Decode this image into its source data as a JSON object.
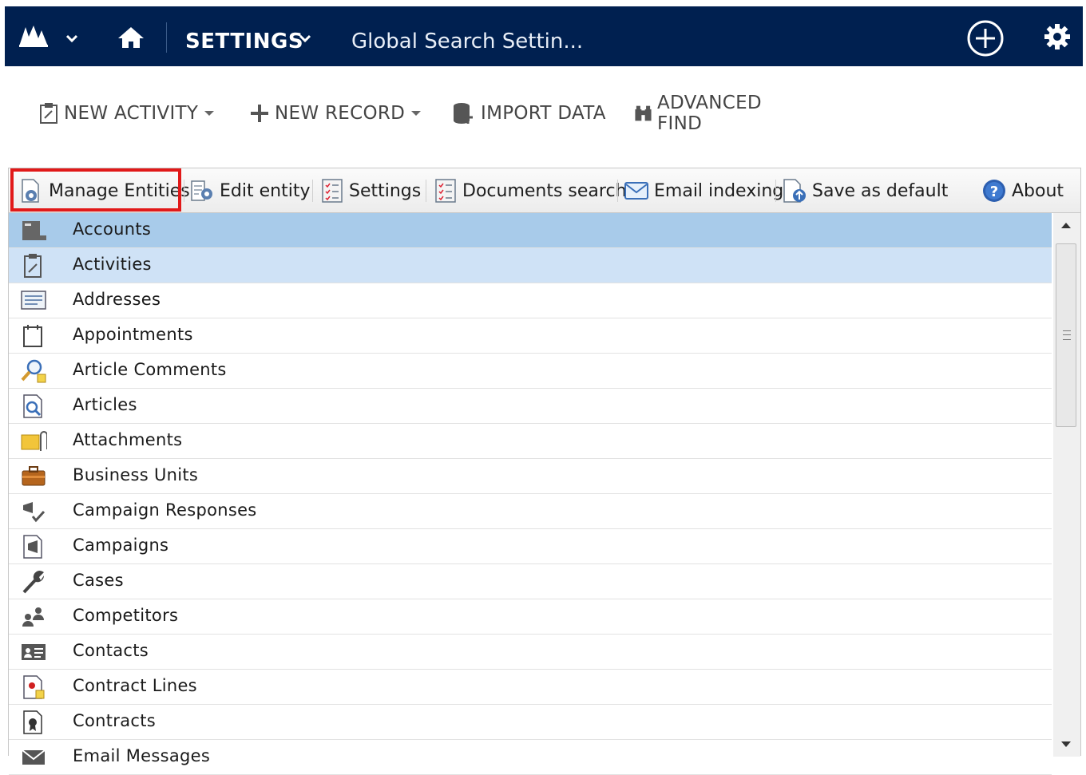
{
  "topnav": {
    "area_title": "SETTINGS",
    "breadcrumb": "Global Search Settin..."
  },
  "commands": {
    "new_activity": "NEW ACTIVITY",
    "new_record": "NEW RECORD",
    "import_data": "IMPORT DATA",
    "advanced_find": "ADVANCED FIND"
  },
  "toolbar": {
    "manage_entities": "Manage Entities",
    "edit_entity": "Edit entity",
    "settings": "Settings",
    "documents_search": "Documents search",
    "email_indexing": "Email indexing",
    "save_as_default": "Save as default",
    "about": "About"
  },
  "colors": {
    "nav_bg": "#002050",
    "selected_row": "#a8cbea",
    "hover_row": "#cfe2f6",
    "highlight_border": "#e11919"
  },
  "entities": [
    {
      "label": "Accounts",
      "icon": "account-icon",
      "state": "selected"
    },
    {
      "label": "Activities",
      "icon": "activity-icon",
      "state": "highlighted"
    },
    {
      "label": "Addresses",
      "icon": "address-icon",
      "state": ""
    },
    {
      "label": "Appointments",
      "icon": "appointment-icon",
      "state": ""
    },
    {
      "label": "Article Comments",
      "icon": "article-comment-icon",
      "state": ""
    },
    {
      "label": "Articles",
      "icon": "article-icon",
      "state": ""
    },
    {
      "label": "Attachments",
      "icon": "attachment-icon",
      "state": ""
    },
    {
      "label": "Business Units",
      "icon": "business-unit-icon",
      "state": ""
    },
    {
      "label": "Campaign Responses",
      "icon": "campaign-response-icon",
      "state": ""
    },
    {
      "label": "Campaigns",
      "icon": "campaign-icon",
      "state": ""
    },
    {
      "label": "Cases",
      "icon": "case-icon",
      "state": ""
    },
    {
      "label": "Competitors",
      "icon": "competitor-icon",
      "state": ""
    },
    {
      "label": "Contacts",
      "icon": "contact-icon",
      "state": ""
    },
    {
      "label": "Contract Lines",
      "icon": "contract-line-icon",
      "state": ""
    },
    {
      "label": "Contracts",
      "icon": "contract-icon",
      "state": ""
    },
    {
      "label": "Email Messages",
      "icon": "email-icon",
      "state": ""
    }
  ]
}
